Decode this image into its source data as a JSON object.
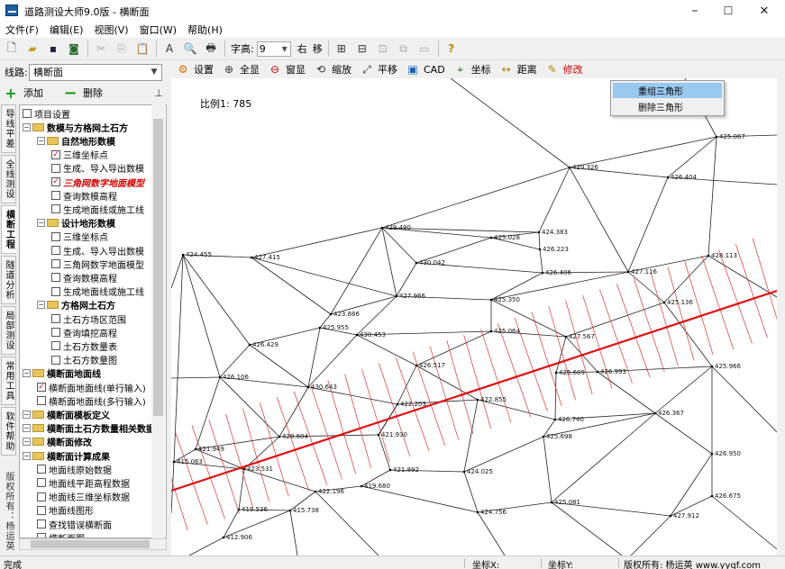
{
  "window": {
    "title": "道路测设大师9.0版 - 横断面",
    "min": "–",
    "max": "☐",
    "close": "✕"
  },
  "menus": [
    "文件(F)",
    "编辑(E)",
    "视图(V)",
    "窗口(W)",
    "帮助(H)"
  ],
  "toolbar1": {
    "font_label": "字高:",
    "font_value": "9",
    "btn_right": "右",
    "btn_move": "移"
  },
  "route": {
    "label": "线路:",
    "value": "横断面"
  },
  "panel": {
    "add": "添加",
    "delete": "删除"
  },
  "vtabs": [
    {
      "label": "导线平差"
    },
    {
      "label": "全线测设"
    },
    {
      "label": "横断工程"
    },
    {
      "label": "隧道分析"
    },
    {
      "label": "局部测设"
    },
    {
      "label": "常用工具"
    },
    {
      "label": "软件帮助"
    }
  ],
  "vtab_footer": "版权所有：杨运英",
  "tree": [
    {
      "label": "项目设置",
      "level": 0,
      "type": "check",
      "checked": false
    },
    {
      "label": "数模与方格网土石方",
      "level": 0,
      "type": "folder",
      "bold": true
    },
    {
      "label": "自然地形数模",
      "level": 1,
      "type": "folder",
      "bold": true
    },
    {
      "label": "三维坐标点",
      "level": 2,
      "type": "check",
      "checked": true
    },
    {
      "label": "生成、导入导出数模",
      "level": 2,
      "type": "check",
      "checked": false
    },
    {
      "label": "三角网数字地面模型",
      "level": 2,
      "type": "check",
      "checked": true,
      "active": true
    },
    {
      "label": "查询数模高程",
      "level": 2,
      "type": "check",
      "checked": false
    },
    {
      "label": "生成地面线或施工线",
      "level": 2,
      "type": "check",
      "checked": false
    },
    {
      "label": "设计地形数模",
      "level": 1,
      "type": "folder",
      "bold": true
    },
    {
      "label": "三维坐标点",
      "level": 2,
      "type": "check",
      "checked": false
    },
    {
      "label": "生成、导入导出数模",
      "level": 2,
      "type": "check",
      "checked": false
    },
    {
      "label": "三角网数字地面模型",
      "level": 2,
      "type": "check",
      "checked": false
    },
    {
      "label": "查询数模高程",
      "level": 2,
      "type": "check",
      "checked": false
    },
    {
      "label": "生成地面线或施工线",
      "level": 2,
      "type": "check",
      "checked": false
    },
    {
      "label": "方格网土石方",
      "level": 1,
      "type": "folder",
      "bold": true
    },
    {
      "label": "土石方场区范围",
      "level": 2,
      "type": "check",
      "checked": false
    },
    {
      "label": "查询填挖高程",
      "level": 2,
      "type": "check",
      "checked": false
    },
    {
      "label": "土石方数量表",
      "level": 2,
      "type": "check",
      "checked": false
    },
    {
      "label": "土石方数量图",
      "level": 2,
      "type": "check",
      "checked": false
    },
    {
      "label": "横断面地面线",
      "level": 0,
      "type": "folder",
      "bold": true
    },
    {
      "label": "横断面地面线(单行输入)",
      "level": 1,
      "type": "check",
      "checked": true
    },
    {
      "label": "横断面地面线(多行输入)",
      "level": 1,
      "type": "check",
      "checked": false
    },
    {
      "label": "横断面模板定义",
      "level": 0,
      "type": "folder",
      "bold": true
    },
    {
      "label": "横断面土石方数量相关数据",
      "level": 0,
      "type": "folder",
      "bold": true
    },
    {
      "label": "横断面修改",
      "level": 0,
      "type": "folder",
      "bold": true
    },
    {
      "label": "横断面计算成果",
      "level": 0,
      "type": "folder",
      "bold": true
    },
    {
      "label": "地面线原始数据",
      "level": 1,
      "type": "check",
      "checked": false
    },
    {
      "label": "地面线平距高程数据",
      "level": 1,
      "type": "check",
      "checked": false
    },
    {
      "label": "地面线三维坐标数据",
      "level": 1,
      "type": "check",
      "checked": false
    },
    {
      "label": "地面线图形",
      "level": 1,
      "type": "check",
      "checked": false
    },
    {
      "label": "查找错误横断面",
      "level": 1,
      "type": "check",
      "checked": false
    },
    {
      "label": "横断面图",
      "level": 1,
      "type": "check",
      "checked": false
    }
  ],
  "toolbar2": [
    {
      "label": "设置",
      "icon": "settings-icon",
      "glyph": "⚙"
    },
    {
      "label": "全显",
      "icon": "zoom-all-icon",
      "glyph": "⊕"
    },
    {
      "label": "窗显",
      "icon": "zoom-window-icon",
      "glyph": "⊖"
    },
    {
      "label": "缩放",
      "icon": "zoom-icon",
      "glyph": "⟲"
    },
    {
      "label": "平移",
      "icon": "pan-icon",
      "glyph": "⤢"
    },
    {
      "label": "CAD",
      "icon": "cad-icon",
      "glyph": "▣"
    },
    {
      "label": "坐标",
      "icon": "coordinate-icon",
      "glyph": "⌖"
    },
    {
      "label": "距离",
      "icon": "distance-icon",
      "glyph": "↔"
    },
    {
      "label": "修改",
      "icon": "edit-icon",
      "glyph": "✎"
    }
  ],
  "canvas": {
    "scale_text": "比例1: 785"
  },
  "context_menu": [
    "重组三角形",
    "删除三角形"
  ],
  "points": [
    {
      "label": "425.067"
    },
    {
      "label": "429.326"
    },
    {
      "label": "426.404"
    },
    {
      "label": "429.490"
    },
    {
      "label": "424.383"
    },
    {
      "label": "425.028"
    },
    {
      "label": "426.223"
    },
    {
      "label": "424.455"
    },
    {
      "label": "427.415"
    },
    {
      "label": "430.042"
    },
    {
      "label": "426.406"
    },
    {
      "label": "427.116"
    },
    {
      "label": "428.113"
    },
    {
      "label": "427.966"
    },
    {
      "label": "425.350"
    },
    {
      "label": "425.136"
    },
    {
      "label": "423.886"
    },
    {
      "label": "425.955"
    },
    {
      "label": "430.453"
    },
    {
      "label": "426.429"
    },
    {
      "label": "425.064"
    },
    {
      "label": "427.567"
    },
    {
      "label": "426.517"
    },
    {
      "label": "425.609"
    },
    {
      "label": "426.106"
    },
    {
      "label": "430.643"
    },
    {
      "label": "426.993"
    },
    {
      "label": "425.966"
    },
    {
      "label": "422.203"
    },
    {
      "label": "422.855"
    },
    {
      "label": "426.740"
    },
    {
      "label": "426.367"
    },
    {
      "label": "428.604"
    },
    {
      "label": "421.930"
    },
    {
      "label": "425.698"
    },
    {
      "label": "421.949"
    },
    {
      "label": "423.531"
    },
    {
      "label": "415.063"
    },
    {
      "label": "421.892"
    },
    {
      "label": "424.025"
    },
    {
      "label": "422.196"
    },
    {
      "label": "419.680"
    },
    {
      "label": "426.950"
    },
    {
      "label": "419.536"
    },
    {
      "label": "415.738"
    },
    {
      "label": "424.756"
    },
    {
      "label": "425.081"
    },
    {
      "label": "426.675"
    },
    {
      "label": "427.912"
    },
    {
      "label": "412.906"
    }
  ],
  "status": {
    "ready": "完成",
    "coord_x": "坐标X:",
    "coord_y": "坐标Y:",
    "copyright": "版权所有: 杨运英 www.yyqf.com"
  }
}
